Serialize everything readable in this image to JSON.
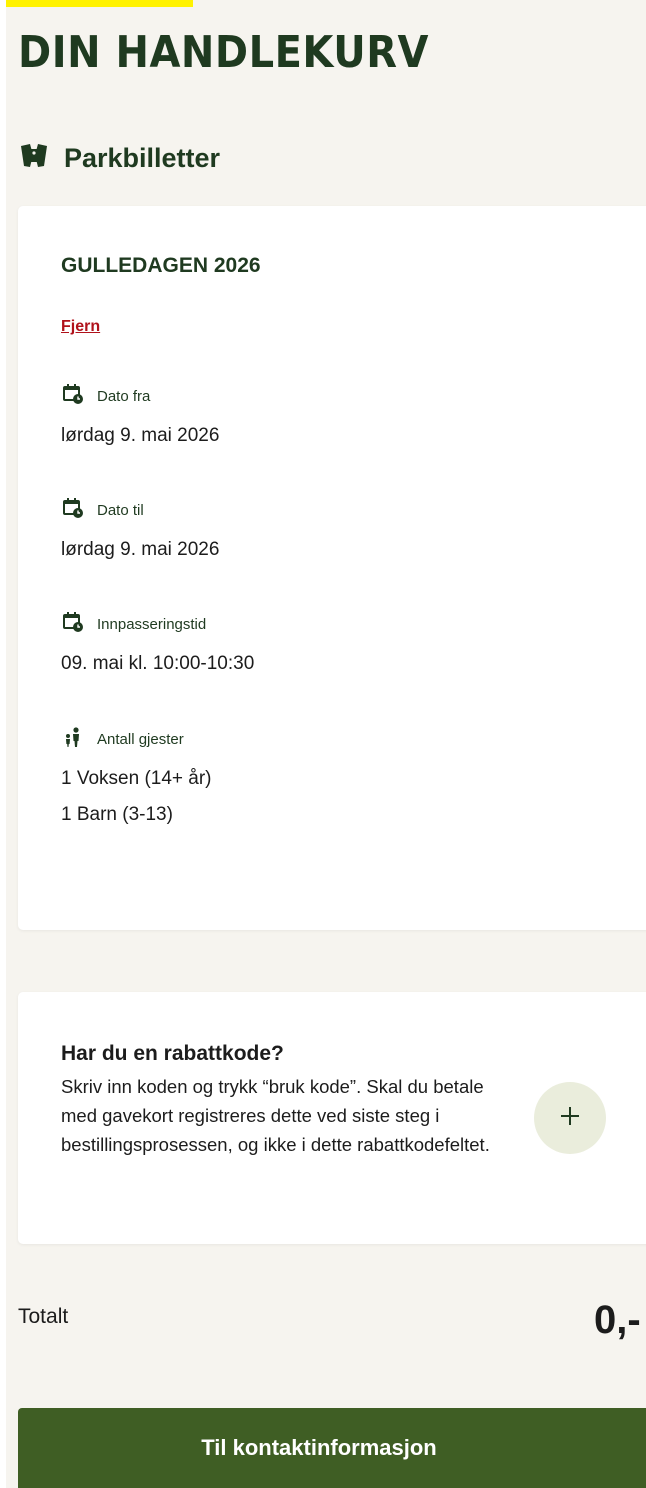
{
  "page": {
    "title": "DIN HANDLEKURV"
  },
  "section": {
    "title": "Parkbilletter",
    "icon": "tickets-icon"
  },
  "ticket": {
    "name": "GULLEDAGEN 2026",
    "remove_label": "Fjern",
    "date_from": {
      "label": "Dato fra",
      "value": "lørdag 9. mai 2026",
      "icon": "calendar-clock-icon"
    },
    "date_to": {
      "label": "Dato til",
      "value": "lørdag 9. mai 2026",
      "icon": "calendar-clock-icon"
    },
    "entry_time": {
      "label": "Innpasseringstid",
      "value": "09. mai kl. 10:00-10:30",
      "icon": "calendar-clock-icon"
    },
    "guests": {
      "label": "Antall gjester",
      "icon": "guests-icon",
      "items": [
        "1 Voksen (14+ år)",
        "1 Barn (3-13)"
      ]
    }
  },
  "discount": {
    "title": "Har du en rabattkode?",
    "text": "Skriv inn koden og trykk “bruk kode”. Skal du betale med gavekort registreres dette ved siste steg i bestillingsprosessen, og ikke i dette rabattkodefeltet.",
    "add_icon": "plus-icon"
  },
  "total": {
    "label": "Totalt",
    "value": "0,-"
  },
  "cta": {
    "label": "Til kontaktinformasjon"
  },
  "colors": {
    "brand_green": "#1f3a20",
    "button_green": "#3f5e24",
    "link_red": "#b0121b",
    "background": "#f6f4ef",
    "highlight": "#fff200"
  }
}
